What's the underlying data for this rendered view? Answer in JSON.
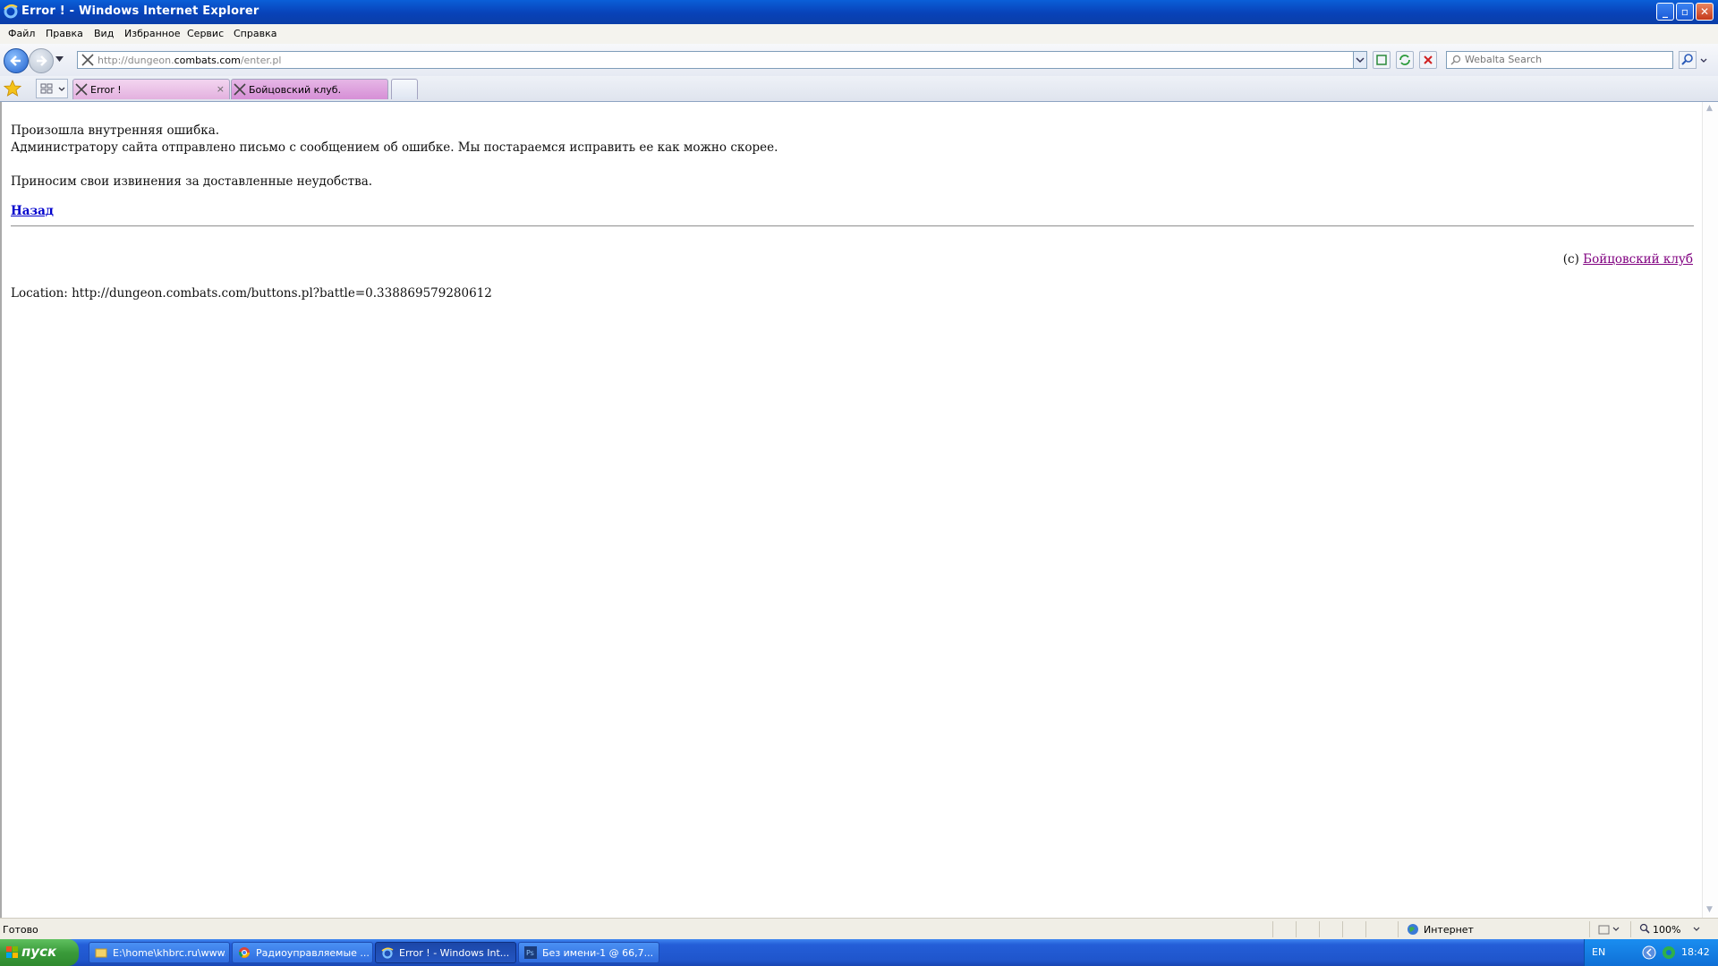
{
  "window": {
    "title": "Error ! - Windows Internet Explorer"
  },
  "menu": [
    "Файл",
    "Правка",
    "Вид",
    "Избранное",
    "Сервис",
    "Справка"
  ],
  "address": {
    "prefix": "http://dungeon.",
    "host": "combats.com",
    "path": "/enter.pl"
  },
  "search": {
    "placeholder": "Webalta Search"
  },
  "tabs": [
    {
      "label": "Error !",
      "close": "×"
    },
    {
      "label": "Бойцовский клуб."
    }
  ],
  "content": {
    "line1": "Произошла внутренняя ошибка.",
    "line2": "Администратору сайта отправлено письмо с сообщением об ошибке. Мы постараемся исправить ее как можно скорее.",
    "line3": "Приносим свои извинения за доставленные неудобства.",
    "back_link": "Назад",
    "copyright_prefix": "(c) ",
    "copyright_link": "Бойцовский клуб",
    "location": "Location: http://dungeon.combats.com/buttons.pl?battle=0.338869579280612"
  },
  "status": {
    "text": "Готово",
    "zone": "Интернет",
    "zoom": "100%"
  },
  "taskbar": {
    "start": "пуск",
    "tasks": [
      {
        "label": "E:\\home\\khbrc.ru\\www..."
      },
      {
        "label": "Радиоуправляемые ..."
      },
      {
        "label": "Error ! - Windows Int..."
      },
      {
        "label": "Без имени-1 @ 66,7..."
      }
    ],
    "lang": "EN",
    "clock": "18:42"
  },
  "colors": {
    "titlebar": "#0a5fd8",
    "link": "#0000cc",
    "visited_link": "#800080",
    "taskbar": "#245ed8",
    "start": "#3a9b3a"
  }
}
